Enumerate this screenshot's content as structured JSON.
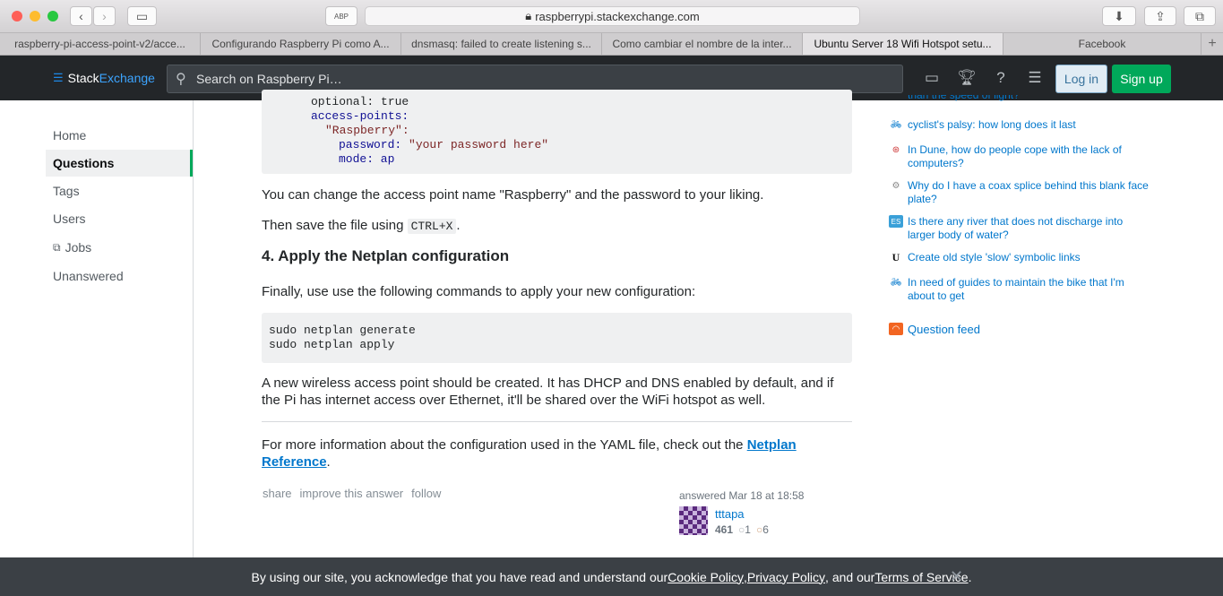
{
  "browser": {
    "url": "raspberrypi.stackexchange.com",
    "tabs": [
      "raspberry-pi-access-point-v2/acce...",
      "Configurando Raspberry Pi como A...",
      "dnsmasq: failed to create listening s...",
      "Como cambiar el nombre de la inter...",
      "Ubuntu Server 18 Wifi Hotspot setu...",
      "Facebook"
    ]
  },
  "header": {
    "logo_a": "Stack",
    "logo_b": "Exchange",
    "search_placeholder": "Search on Raspberry Pi…",
    "login": "Log in",
    "signup": "Sign up"
  },
  "leftnav": [
    "Home",
    "Questions",
    "Tags",
    "Users",
    "Jobs",
    "Unanswered"
  ],
  "post": {
    "code1_cut": "optional: true",
    "code1_l1": "access-points:",
    "code1_l2": "\"Raspberry\":",
    "code1_l3a": "password: ",
    "code1_l3b": "\"your password here\"",
    "code1_l4": "mode: ap",
    "p1": "You can change the access point name \"Raspberry\" and the password to your liking.",
    "p2a": "Then save the file using ",
    "p2_kbd": "CTRL+X",
    "p2b": ".",
    "h4": "4. Apply the Netplan configuration",
    "p3": "Finally, use use the following commands to apply your new configuration:",
    "code2": "sudo netplan generate\nsudo netplan apply",
    "p4": "A new wireless access point should be created. It has DHCP and DNS enabled by default, and if the Pi has internet access over Ethernet, it'll be shared over the WiFi hotspot as well.",
    "p5a": "For more information about the configuration used in the YAML file, check out the ",
    "p5_link": "Netplan Reference",
    "p5b": ".",
    "share": "share",
    "improve": "improve this answer",
    "follow": "follow",
    "answered": "answered Mar 18 at 18:58",
    "user": "tttapa",
    "rep": "461",
    "silver": "1",
    "bronze": "6"
  },
  "sidebar": {
    "cut": "than the speed of light?",
    "items": [
      "cyclist's palsy: how long does it last",
      "In Dune, how do people cope with the lack of computers?",
      "Why do I have a coax splice behind this blank face plate?",
      "Is there any river that does not discharge into larger body of water?",
      "Create old style 'slow' symbolic links",
      "In need of guides to maintain the bike that I'm about to get"
    ],
    "feed": "Question feed"
  },
  "cookie": {
    "t1": "By using our site, you acknowledge that you have read and understand our ",
    "cookie": "Cookie Policy",
    "sep1": ", ",
    "privacy": "Privacy Policy",
    "sep2": ", and our ",
    "terms": "Terms of Service",
    "end": "."
  }
}
